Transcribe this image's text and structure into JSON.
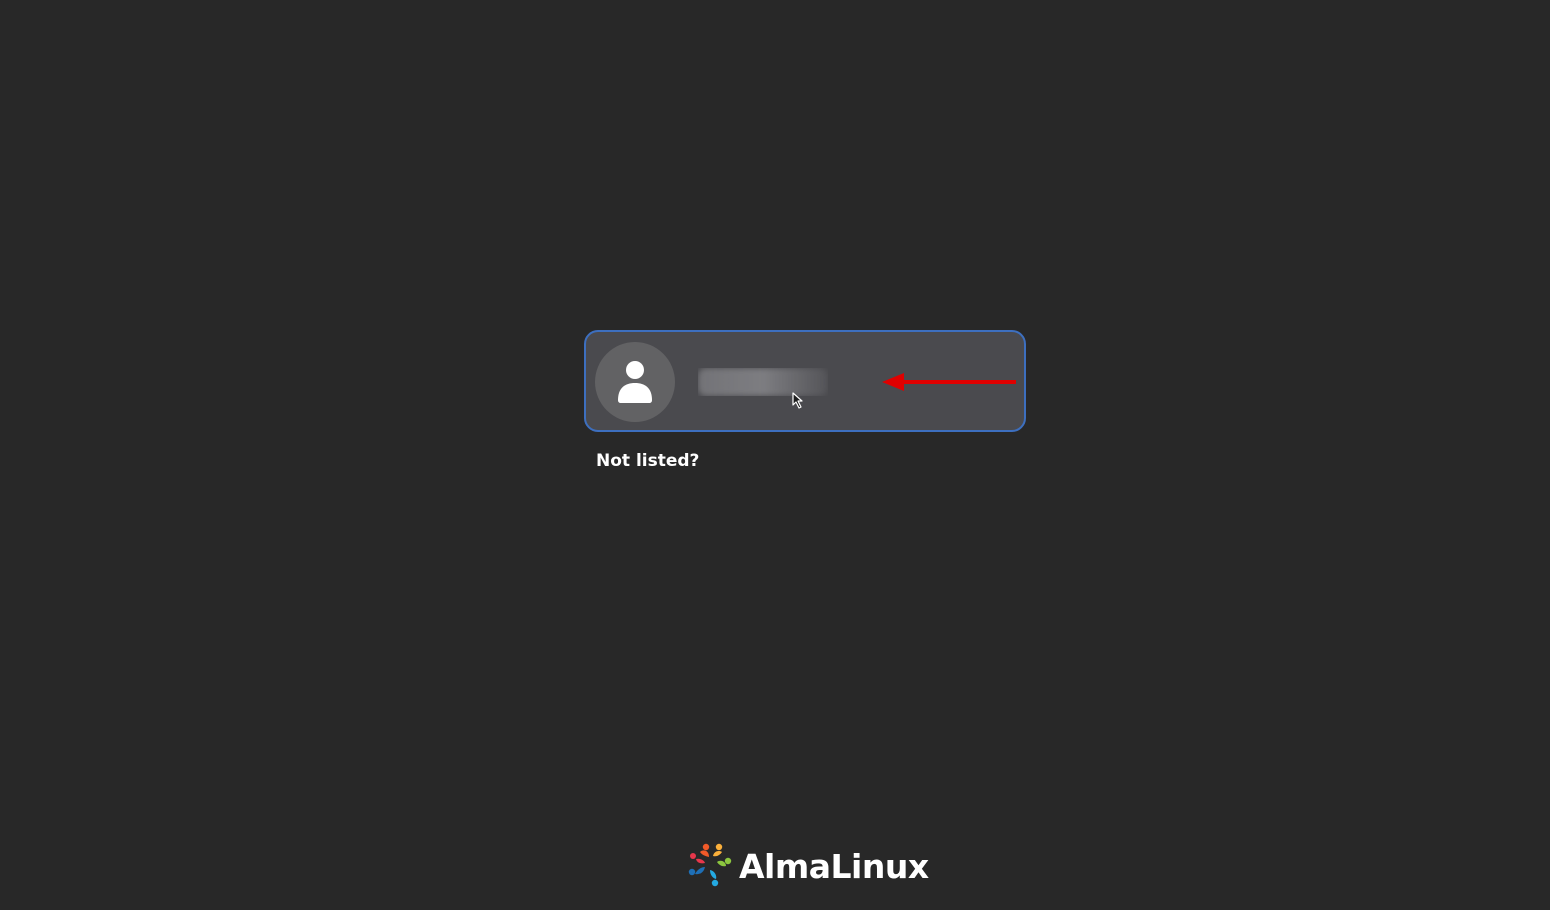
{
  "login": {
    "user": {
      "name": "",
      "avatar_icon": "user-avatar-icon"
    },
    "not_listed_label": "Not listed?"
  },
  "annotation": {
    "arrow_color": "#e00000",
    "arrow_icon": "left-arrow-icon"
  },
  "branding": {
    "logo_icon": "almalinux-logo-icon",
    "name": "AlmaLinux"
  },
  "colors": {
    "background": "#282828",
    "user_row": "#4a4a4e",
    "user_row_border": "#3d6fbf",
    "avatar_bg": "#626264",
    "text": "#ffffff"
  }
}
